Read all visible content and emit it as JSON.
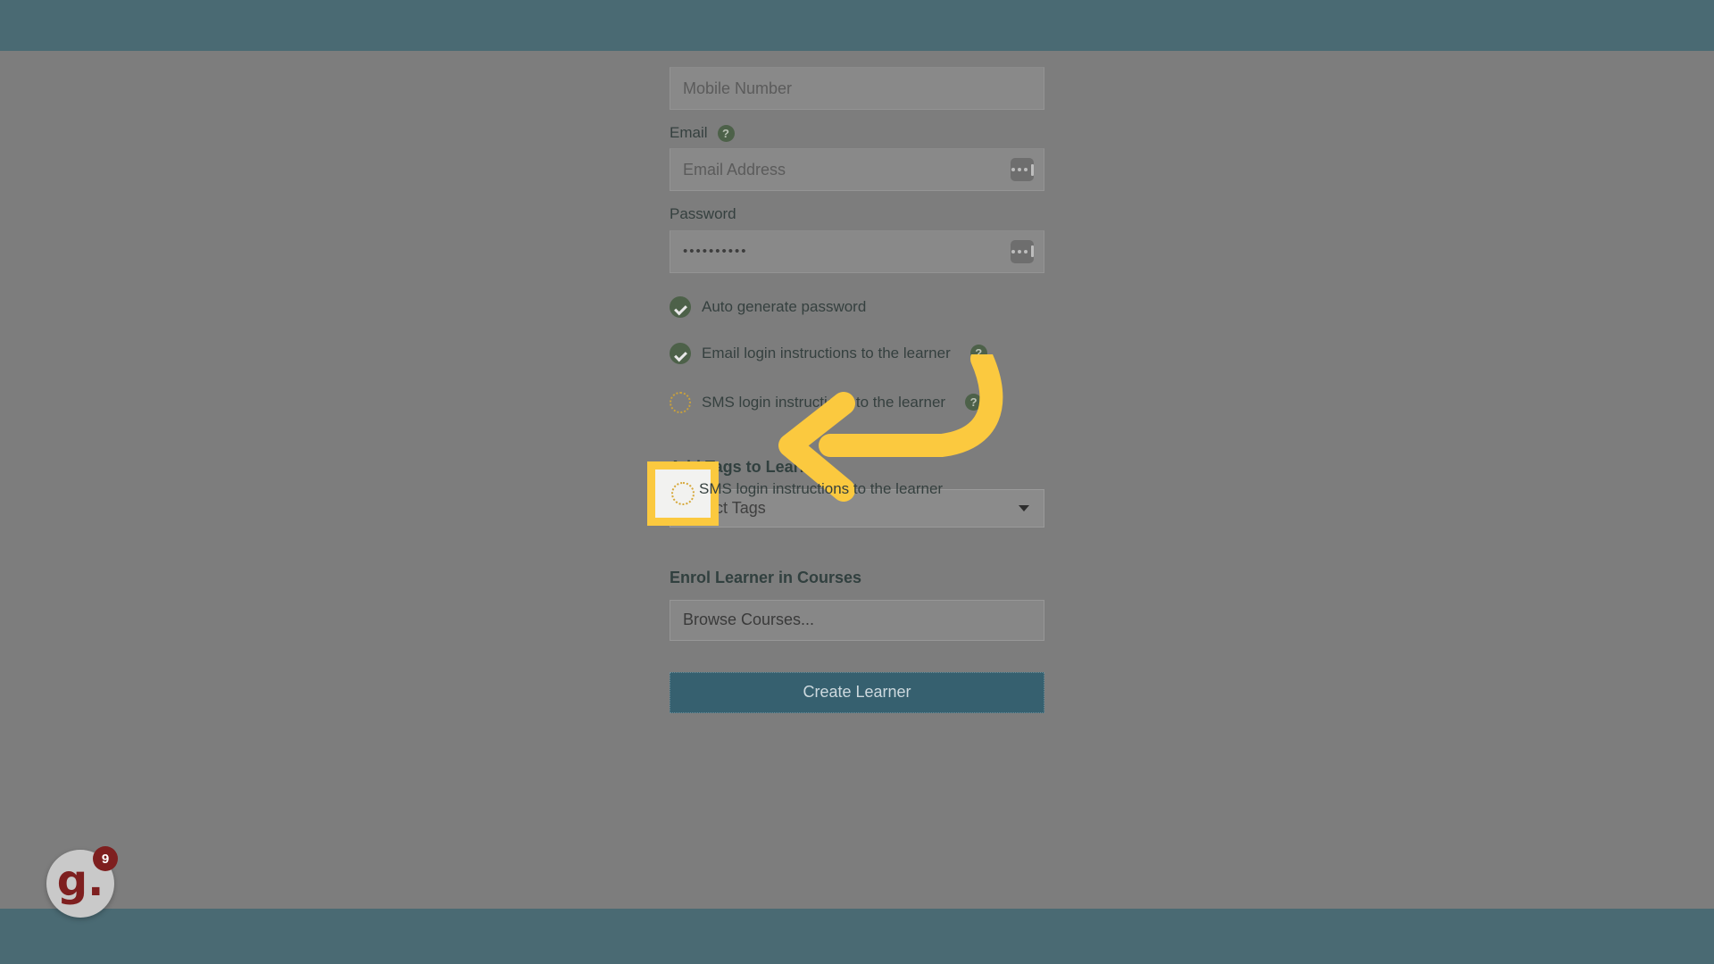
{
  "theme": {
    "header_bar_color": "#4a6a73",
    "footer_bar_color": "#4a6a73",
    "overlay_color": "#7d7d7d",
    "primary_button_color": "#36606f",
    "highlight_color": "#fbc93f",
    "check_color": "#4d6149",
    "badge_color": "#7e1f1f"
  },
  "form": {
    "mobile": {
      "placeholder": "Mobile Number",
      "value": ""
    },
    "email": {
      "label": "Email",
      "help_icon": "question-mark-circle-icon",
      "placeholder": "Email Address",
      "value": "",
      "autofill_icon": "autofill-ellipsis-icon"
    },
    "password": {
      "label": "Password",
      "value": "••••••••••",
      "autofill_icon": "autofill-ellipsis-icon"
    },
    "checkboxes": [
      {
        "label": "Auto generate password",
        "checked": true,
        "has_help": false,
        "icon": "check-circle-icon"
      },
      {
        "label": "Email login instructions to the learner",
        "checked": true,
        "has_help": true,
        "help_icon": "question-mark-circle-icon",
        "icon": "check-circle-icon"
      },
      {
        "label": "SMS login instructions to the learner",
        "checked": false,
        "has_help": true,
        "help_icon": "question-mark-circle-icon",
        "icon": "empty-circle-icon",
        "highlighted": true
      }
    ],
    "tags_section": {
      "title": "Add Tags to Learner",
      "select_value": "Select Tags",
      "caret_icon": "chevron-down-icon"
    },
    "courses_section": {
      "title": "Enrol Learner in Courses",
      "browse_value": "Browse Courses..."
    },
    "submit": {
      "label": "Create Learner"
    }
  },
  "annotation": {
    "type": "curved-arrow",
    "points_to": "SMS login instructions checkbox",
    "color": "#fbc93f"
  },
  "chat_widget": {
    "logo_text": "g.",
    "unread_count": "9"
  }
}
